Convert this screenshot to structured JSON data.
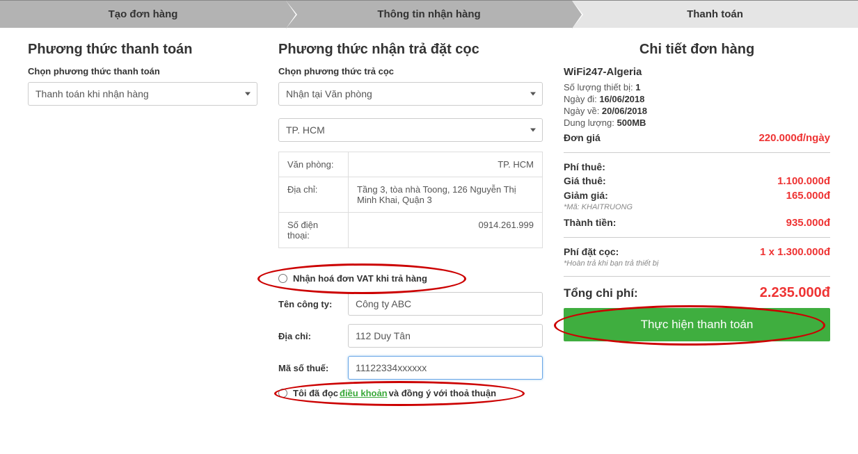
{
  "steps": {
    "s1": "Tạo đơn hàng",
    "s2": "Thông tin nhận hàng",
    "s3": "Thanh toán"
  },
  "payment": {
    "title": "Phương thức thanh toán",
    "sub": "Chọn phương thức thanh toán",
    "selected": "Thanh toán khi nhận hàng"
  },
  "deposit": {
    "title": "Phương thức nhận trả đặt cọc",
    "sub": "Chọn phương thức trả cọc",
    "method_selected": "Nhận tại Văn phòng",
    "city_selected": "TP. HCM",
    "rows": {
      "office_lbl": "Văn phòng:",
      "office_val": "TP. HCM",
      "addr_lbl": "Địa chỉ:",
      "addr_val": "Tầng 3, tòa nhà Toong, 126 Nguyễn Thị Minh Khai, Quận 3",
      "phone_lbl": "Số điện thoại:",
      "phone_val": "0914.261.999"
    }
  },
  "vat": {
    "check_label": "Nhận hoá đơn VAT khi trả hàng",
    "company_lbl": "Tên công ty:",
    "company_val": "Công ty ABC",
    "addr_lbl": "Địa chỉ:",
    "addr_val": "112 Duy Tân",
    "tax_lbl": "Mã số thuế:",
    "tax_val": "11122334xxxxxx"
  },
  "terms": {
    "prefix": "Tôi đã đọc ",
    "link": "điều khoản ",
    "suffix": "và đồng ý với thoả thuận"
  },
  "order": {
    "title": "Chi tiết đơn hàng",
    "name": "WiFi247-Algeria",
    "qty_lbl": "Số lượng thiết bị: ",
    "qty_val": "1",
    "depart_lbl": "Ngày đi: ",
    "depart_val": "16/06/2018",
    "return_lbl": "Ngày về: ",
    "return_val": "20/06/2018",
    "data_lbl": "Dung lượng: ",
    "data_val": "500MB",
    "unitprice_lbl": "Đơn giá",
    "unitprice_val": "220.000đ/ngày",
    "fee_title": "Phí thuê:",
    "rent_lbl": "Giá thuê:",
    "rent_val": "1.100.000đ",
    "disc_lbl": "Giảm giá:",
    "disc_val": "165.000đ",
    "coupon_hint": "*Mã: KHAITRUONG",
    "subtotal_lbl": "Thành tiền:",
    "subtotal_val": "935.000đ",
    "depfee_lbl": "Phí đặt cọc:",
    "depfee_val": "1 x 1.300.000đ",
    "depfee_hint": "*Hoàn trả khi bạn trả thiết bị",
    "total_lbl": "Tổng chi phí:",
    "total_val": "2.235.000đ",
    "pay_btn": "Thực hiện thanh toán"
  }
}
